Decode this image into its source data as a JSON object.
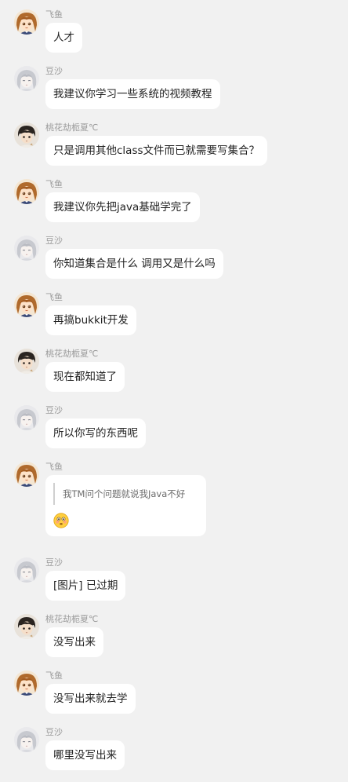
{
  "colors": {
    "background": "#f1f1f1",
    "bubble": "#ffffff",
    "sender_name": "#9a9a9a"
  },
  "users": {
    "feiyu": {
      "name": "飞鱼",
      "avatar": "anime-girl-brown-hair-avatar"
    },
    "dousha": {
      "name": "豆沙",
      "avatar": "anime-grey-hair-avatar"
    },
    "taohua": {
      "name": "桃花劫栀夏℃",
      "avatar": "anime-dark-hair-avatar"
    }
  },
  "messages": [
    {
      "user": "feiyu",
      "name": "飞鱼",
      "text": "人才"
    },
    {
      "user": "dousha",
      "name": "豆沙",
      "text": "我建议你学习一些系统的视频教程"
    },
    {
      "user": "taohua",
      "name": "桃花劫栀夏℃",
      "text": "只是调用其他class文件而已就需要写集合？"
    },
    {
      "user": "feiyu",
      "name": "飞鱼",
      "text": "我建议你先把java基础学完了"
    },
    {
      "user": "dousha",
      "name": "豆沙",
      "text": "你知道集合是什么 调用又是什么吗"
    },
    {
      "user": "feiyu",
      "name": "飞鱼",
      "text": "再搞bukkit开发"
    },
    {
      "user": "taohua",
      "name": "桃花劫栀夏℃",
      "text": "现在都知道了"
    },
    {
      "user": "dousha",
      "name": "豆沙",
      "text": "所以你写的东西呢"
    },
    {
      "user": "feiyu",
      "name": "飞鱼",
      "quote": "我TM问个问题就说我Java不好",
      "emoji": "flushed-face-emoji"
    },
    {
      "user": "dousha",
      "name": "豆沙",
      "text": "[图片] 已过期"
    },
    {
      "user": "taohua",
      "name": "桃花劫栀夏℃",
      "text": "没写出来"
    },
    {
      "user": "feiyu",
      "name": "飞鱼",
      "text": "没写出来就去学"
    },
    {
      "user": "dousha",
      "name": "豆沙",
      "text": "哪里没写出来"
    }
  ]
}
